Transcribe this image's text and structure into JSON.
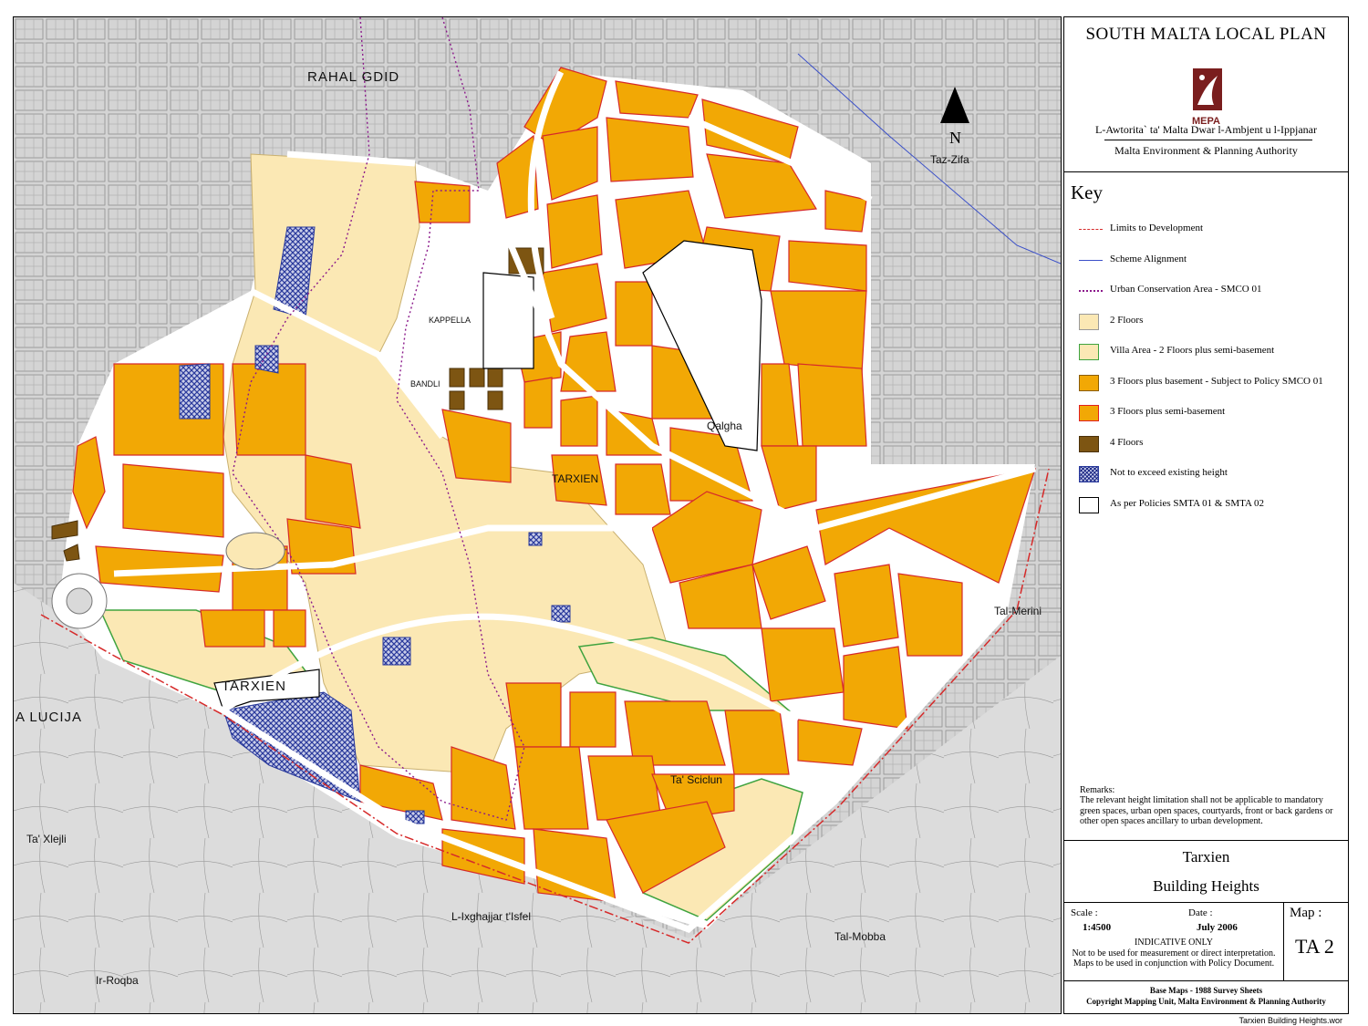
{
  "panel": {
    "plan_title": "SOUTH MALTA LOCAL PLAN",
    "logo_text": "MEPA",
    "authority_maltese": "L-Awtorita` ta' Malta Dwar l-Ambjent u l-Ippjanar",
    "authority_english": "Malta Environment & Planning Authority",
    "key_title": "Key",
    "key": [
      {
        "label": "Limits to Development",
        "style": "line-dashdot",
        "color": "#d62a2a"
      },
      {
        "label": "Scheme Alignment",
        "style": "line-solid",
        "color": "#3a4fc8"
      },
      {
        "label": "Urban Conservation Area - SMCO 01",
        "style": "line-dotted",
        "color": "#8b1a8b"
      },
      {
        "label": "2 Floors",
        "style": "fill",
        "color": "#fbe8b4",
        "border": "#999999"
      },
      {
        "label": "Villa Area - 2 Floors plus semi-basement",
        "style": "fill",
        "color": "#fbe8b4",
        "border": "#3fa33f"
      },
      {
        "label": "3 Floors plus basement - Subject to Policy SMCO 01",
        "style": "fill",
        "color": "#f2a805",
        "border": "#8a5c00"
      },
      {
        "label": "3 Floors plus semi-basement",
        "style": "fill",
        "color": "#f2a805",
        "border": "#e02020"
      },
      {
        "label": "4 Floors",
        "style": "fill",
        "color": "#7d5512",
        "border": "#4a3008"
      },
      {
        "label": "Not to exceed existing height",
        "style": "hatch",
        "color": "#2a3a9c",
        "border": "#2a3a9c"
      },
      {
        "label": "As per Policies SMTA 01 & SMTA 02",
        "style": "outline",
        "color": "#ffffff",
        "border": "#000000"
      }
    ],
    "remarks_title": "Remarks:",
    "remarks_text": "The relevant height limitation shall not be applicable to mandatory green spaces, urban open spaces, courtyards, front or back gardens or other open spaces ancillary to urban development.",
    "place_name": "Tarxien",
    "map_subject": "Building Heights",
    "scale_label": "Scale :",
    "scale_value": "1:4500",
    "date_label": "Date :",
    "date_value": "July 2006",
    "indicative_title": "INDICATIVE ONLY",
    "indicative_line1": "Not to be used for measurement or direct interpretation.",
    "indicative_line2": "Maps to be used in conjunction with Policy Document.",
    "map_label": "Map :",
    "map_number": "TA 2",
    "base_maps": "Base Maps - 1988 Survey Sheets",
    "copyright": "Copyright Mapping Unit, Malta Environment & Planning Authority"
  },
  "map": {
    "north_label": "N",
    "place_labels": [
      "RAHAL GDID",
      "TARXIEN",
      "TARXIEN",
      "A LUCIJA",
      "Qalgha",
      "Tal-Mobba",
      "Ir-Roqba",
      "Ta' Xlejli",
      "Tal-Merini",
      "Taz-Zifa",
      "L-Ixghajjar t'Isfel",
      "Ta' Sciclun",
      "KAPPELLA",
      "BANDLI"
    ],
    "colors": {
      "background": "#d9d9d9",
      "road": "#ffffff",
      "two_floors": "#fbe8b4",
      "three_floors": "#f2a805",
      "four_floors": "#7d5512",
      "hatch": "#2a3a9c",
      "limit_line": "#d62a2a",
      "scheme_line": "#3a4fc8",
      "conservation_line": "#8b1a8b",
      "villa_border": "#3fa33f"
    }
  },
  "footer": {
    "filename": "Tarxien Building Heights.wor"
  }
}
